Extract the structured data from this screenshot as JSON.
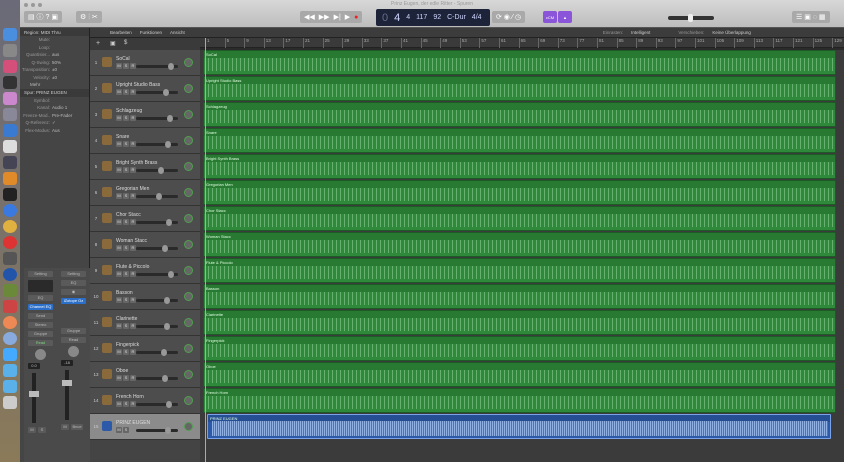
{
  "window": {
    "title": "Prinz Eugen, der edle Ritter - Spuren"
  },
  "lcd": {
    "bar": "4",
    "beat": "4",
    "div": "117",
    "tick": "92",
    "key": "C-Dur",
    "sig": "4/4",
    "pos_prefix": "0",
    "labels": [
      "TAKT",
      "BEAT",
      "DIV",
      "TICK",
      "TEMPO",
      "TONART",
      "TAKT"
    ]
  },
  "toolbar": {
    "lcm": "cCM",
    "snap_label": "Einrasten:",
    "snap_value": "Intelligent",
    "move_label": "Verschieben:",
    "move_value": "Keine Überlappung"
  },
  "menus": [
    "Bearbeiten",
    "Funktionen",
    "Ansicht"
  ],
  "inspector": {
    "region": "Region: MIDI Thru",
    "rows": [
      {
        "k": "Mute:",
        "v": ""
      },
      {
        "k": "Loop:",
        "v": ""
      },
      {
        "k": "Quantisier...",
        "v": "aus"
      },
      {
        "k": "Q-Swing:",
        "v": "50%"
      },
      {
        "k": "Transposition:",
        "v": "±0"
      },
      {
        "k": "Velocity:",
        "v": "±0"
      }
    ],
    "more": "Mehr",
    "track": "Spur: PRINZ EUGEN",
    "trows": [
      {
        "k": "Symbol:",
        "v": ""
      },
      {
        "k": "Kanal:",
        "v": "Audio 1"
      },
      {
        "k": "Freeze-Mod..",
        "v": "Pre-Fader"
      },
      {
        "k": "Q-Referenz:",
        "v": "✓"
      },
      {
        "k": "Flex-Modus:",
        "v": "Aus"
      }
    ]
  },
  "strips": [
    {
      "setting": "Setting",
      "eq": "EQ",
      "plugin": "Channel EQ",
      "send": "Send",
      "stereo": "Stereo",
      "group": "Gruppe",
      "auto": "Read",
      "vol": "0.0",
      "m": "M",
      "s": "S"
    },
    {
      "setting": "Setting",
      "eq": "EQ",
      "plugin": "iZotope Oz",
      "send": "",
      "stereo": "",
      "group": "Gruppe",
      "auto": "Read",
      "vol": "-18",
      "m": "M",
      "s": "Bnce"
    }
  ],
  "ruler": [
    "1",
    "5",
    "9",
    "13",
    "17",
    "21",
    "25",
    "29",
    "33",
    "37",
    "41",
    "45",
    "49",
    "53",
    "57",
    "61",
    "65",
    "69",
    "73",
    "77",
    "81",
    "85",
    "89",
    "93",
    "97",
    "101",
    "105",
    "109",
    "113",
    "117",
    "121",
    "125",
    "129"
  ],
  "tracks": [
    {
      "n": "1",
      "name": "SoCal",
      "icon": "drums-icon"
    },
    {
      "n": "2",
      "name": "Upright Studio Bass",
      "icon": "bass-icon"
    },
    {
      "n": "3",
      "name": "Schlagzeug",
      "icon": "drums-icon"
    },
    {
      "n": "4",
      "name": "Snare",
      "icon": "snare-icon"
    },
    {
      "n": "5",
      "name": "Bright Synth Brass",
      "icon": "synth-icon"
    },
    {
      "n": "6",
      "name": "Gregorian Men",
      "icon": "choir-icon"
    },
    {
      "n": "7",
      "name": "Chor Stacc",
      "icon": "choir-icon"
    },
    {
      "n": "8",
      "name": "Woman Stacc",
      "icon": "voice-icon"
    },
    {
      "n": "9",
      "name": "Flute & Piccolo",
      "icon": "flute-icon"
    },
    {
      "n": "10",
      "name": "Basson",
      "icon": "bassoon-icon"
    },
    {
      "n": "11",
      "name": "Clarinette",
      "icon": "clarinet-icon"
    },
    {
      "n": "12",
      "name": "Fingerpick",
      "icon": "guitar-icon"
    },
    {
      "n": "13",
      "name": "Oboe",
      "icon": "oboe-icon"
    },
    {
      "n": "14",
      "name": "French Horn",
      "icon": "horn-icon"
    },
    {
      "n": "15",
      "name": "PRINZ EUGEN",
      "icon": "waveform-icon"
    }
  ],
  "regions": [
    "SoCal",
    "Upright Studio Bass",
    "Schlagzeug",
    "Snare",
    "Bright Synth Brass",
    "Gregorian Men",
    "Chor Stacc",
    "Woman Stacc",
    "Flute & Piccolo",
    "Basson",
    "Clarinette",
    "Fingerpick",
    "Oboe",
    "French Horn",
    "PRINZ EUGEN"
  ],
  "fader_levels": [
    0.9,
    0.75,
    0.85,
    0.8,
    0.6,
    0.55,
    0.82,
    0.72,
    0.88,
    0.78,
    0.78,
    0.7,
    0.72,
    0.82,
    0.8
  ],
  "colors": {
    "midi": "#2e8a3a",
    "audio": "#2c5aa8",
    "lcd": "#1d2338",
    "accent": "#8a55d8"
  }
}
